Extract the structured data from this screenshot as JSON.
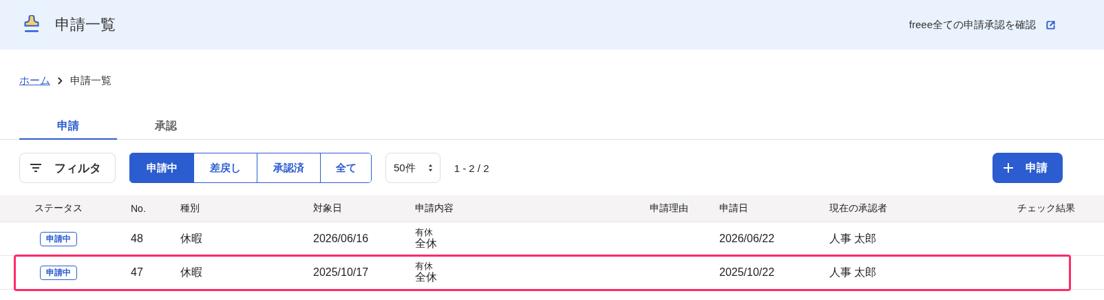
{
  "header": {
    "title": "申請一覧",
    "external_link": "freee全ての申請承認を確認"
  },
  "breadcrumb": [
    {
      "label": "ホーム",
      "link": true
    },
    {
      "label": "申請一覧",
      "link": false
    }
  ],
  "tabs": [
    {
      "label": "申請",
      "selected": true
    },
    {
      "label": "承認",
      "selected": false
    }
  ],
  "toolbar": {
    "filter_button": "フィルタ",
    "status_filters": [
      {
        "label": "申請中",
        "selected": true
      },
      {
        "label": "差戻し",
        "selected": false
      },
      {
        "label": "承認済",
        "selected": false
      },
      {
        "label": "全て",
        "selected": false
      }
    ],
    "page_size": "50件",
    "range": "1 - 2 / 2",
    "new_button": "申請"
  },
  "table": {
    "columns": [
      "ステータス",
      "No.",
      "種別",
      "対象日",
      "申請内容",
      "申請理由",
      "申請日",
      "現在の承認者",
      "チェック結果"
    ],
    "rows": [
      {
        "status": "申請中",
        "no": "48",
        "kind": "休暇",
        "target_date": "2026/06/16",
        "content": [
          "有休",
          "全休"
        ],
        "applied_date": "2026/06/22",
        "approver": "人事 太郎",
        "highlighted": false
      },
      {
        "status": "申請中",
        "no": "47",
        "kind": "休暇",
        "target_date": "2025/10/17",
        "content": [
          "有休",
          "全休"
        ],
        "applied_date": "2025/10/22",
        "approver": "人事 太郎",
        "highlighted": true
      }
    ]
  }
}
